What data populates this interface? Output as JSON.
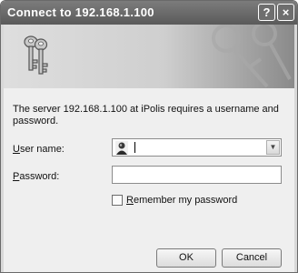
{
  "window": {
    "title": "Connect to 192.168.1.100",
    "help_label": "?",
    "close_label": "×"
  },
  "dialog": {
    "message": "The server 192.168.1.100 at iPolis requires a username and password.",
    "username": {
      "label_accesskey": "U",
      "label_rest": "ser name:",
      "value": "",
      "icon": "user-account-icon"
    },
    "password": {
      "label_accesskey": "P",
      "label_rest": "assword:",
      "value": ""
    },
    "remember": {
      "label_accesskey": "R",
      "label_rest": "emember my password",
      "checked": false
    },
    "buttons": {
      "ok": "OK",
      "cancel": "Cancel"
    }
  },
  "banner": {
    "icon": "keys-icon"
  },
  "colors": {
    "titlebar": "#5a5a5a",
    "dialog_bg": "#efefef"
  }
}
